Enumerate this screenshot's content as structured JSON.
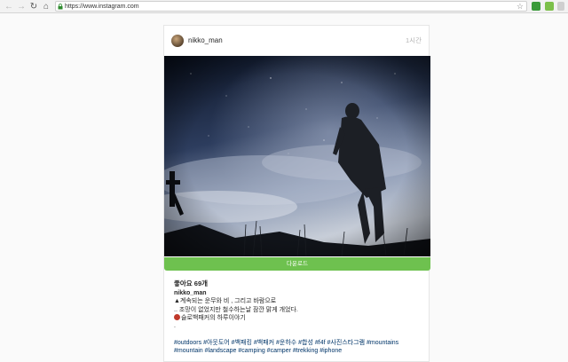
{
  "browser": {
    "url": "https://www.instagram.com",
    "nav_back": "←",
    "nav_forward": "→",
    "nav_reload": "↻",
    "nav_home": "⌂",
    "bookmark_star": "☆"
  },
  "post": {
    "username": "nikko_man",
    "time_ago": "1시간",
    "download_label": "다운로드",
    "likes": "좋아요 69개",
    "caption_user": "nikko_man",
    "caption_lines": [
      "▲계속되는 운무와 비 , 그리고 바람으로",
      ".. 조망이 없었지만 철수하는날 잠깐 맑게 개었다.",
      "슬로백패커의 하루이야기",
      "."
    ],
    "hashtags": "#outdoors #아웃도어 #백패킹 #백패커 #운하수 #합성 #f4f #사진스타그램 #mountains #mountain #landscape #camping #camper #trekking #iphone"
  },
  "colors": {
    "download_button": "#6ec14f",
    "hashtag": "#003569",
    "timestamp": "#b3b3b3"
  },
  "icons": [
    "back-arrow-icon",
    "forward-arrow-icon",
    "reload-icon",
    "home-icon",
    "lock-icon",
    "bookmark-star-icon",
    "extension-icon"
  ]
}
